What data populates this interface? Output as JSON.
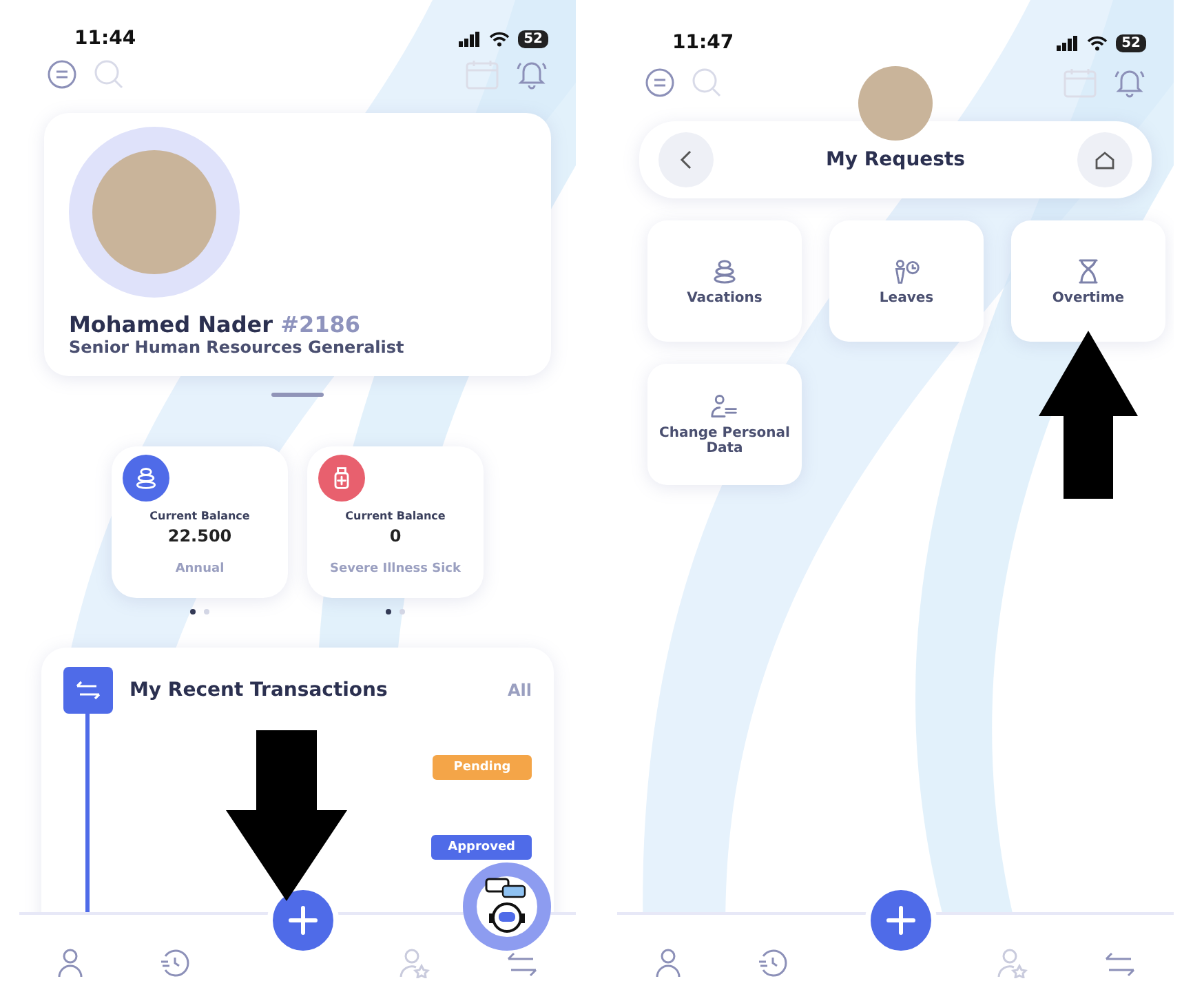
{
  "screens": [
    {
      "status_bar": {
        "time": "11:44",
        "battery": "52"
      },
      "profile": {
        "name": "Mohamed Nader",
        "id": "#2186",
        "job_title": "Senior Human Resources Generalist"
      },
      "balances": [
        {
          "kind": "stones",
          "color": "#4f6be8",
          "label": "Current Balance",
          "value": "22.500",
          "type": "Annual",
          "dots": [
            {
              "selected": true
            },
            {
              "selected": false
            }
          ]
        },
        {
          "kind": "medicine",
          "color": "#e8606e",
          "label": "Current Balance",
          "value": "0",
          "type": "Severe Illness Sick",
          "dots": [
            {
              "selected": true
            },
            {
              "selected": false
            }
          ]
        }
      ],
      "transactions": {
        "title": "My Recent Transactions",
        "all_link": "All",
        "items": [
          {
            "status": "Pending",
            "color": "#f4a548"
          },
          {
            "status": "Approved",
            "color": "#4f6be8"
          }
        ]
      }
    },
    {
      "status_bar": {
        "time": "11:47",
        "battery": "52"
      },
      "header": {
        "title": "My Requests"
      },
      "requests": [
        {
          "kind": "stones",
          "label": "Vacations"
        },
        {
          "kind": "person-clock",
          "label": "Leaves"
        },
        {
          "kind": "hourglass",
          "label": "Overtime"
        },
        {
          "kind": "person-list",
          "label": "Change Personal Data"
        }
      ]
    }
  ]
}
